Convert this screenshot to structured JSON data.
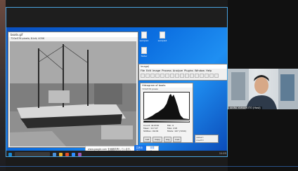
{
  "image_window": {
    "title": "boats.gif",
    "info": "720x576 pixels; 8-bit; 405K"
  },
  "desktop_icons": [
    {
      "label": "sample1"
    },
    {
      "label": "sample2"
    },
    {
      "label": "folder"
    }
  ],
  "imagej": {
    "title": "ImageJ",
    "menus": [
      "File",
      "Edit",
      "Image",
      "Process",
      "Analyze",
      "Plugins",
      "Window",
      "Help"
    ],
    "tool_icons": [
      "rectangle-tool-icon",
      "oval-tool-icon",
      "polygon-tool-icon",
      "freehand-tool-icon",
      "line-tool-icon",
      "angle-tool-icon",
      "point-tool-icon",
      "wand-tool-icon",
      "text-tool-icon",
      "zoom-tool-icon",
      "hand-tool-icon",
      "dropper-tool-icon",
      "custom-tool-icon",
      "lut-tool-icon",
      "dev-tool-icon",
      "more-tools-icon"
    ]
  },
  "histogram": {
    "title": "Histogram of boats",
    "subtitle": "720x576 pixels",
    "stats": [
      {
        "label": "Count: 414720",
        "value": "Min: 0"
      },
      {
        "label": "Mean: 117.07",
        "value": "Max: 218"
      },
      {
        "label": "StdDev: 49.09",
        "value": "Mode: 197 (7240)"
      }
    ],
    "buttons": [
      "List",
      "Copy",
      "Log",
      "Live"
    ]
  },
  "small_dialog": {
    "line1": "value=",
    "line2": "count="
  },
  "notice_bar": {
    "text": "www.google.com を画面共有しています。",
    "share_btn": "共有を停止",
    "hide_btn": "非表示"
  },
  "taskbar": {
    "clock": "11:23"
  },
  "webcam": {
    "name": "AKIRA YAMAMOTO (Host)"
  }
}
